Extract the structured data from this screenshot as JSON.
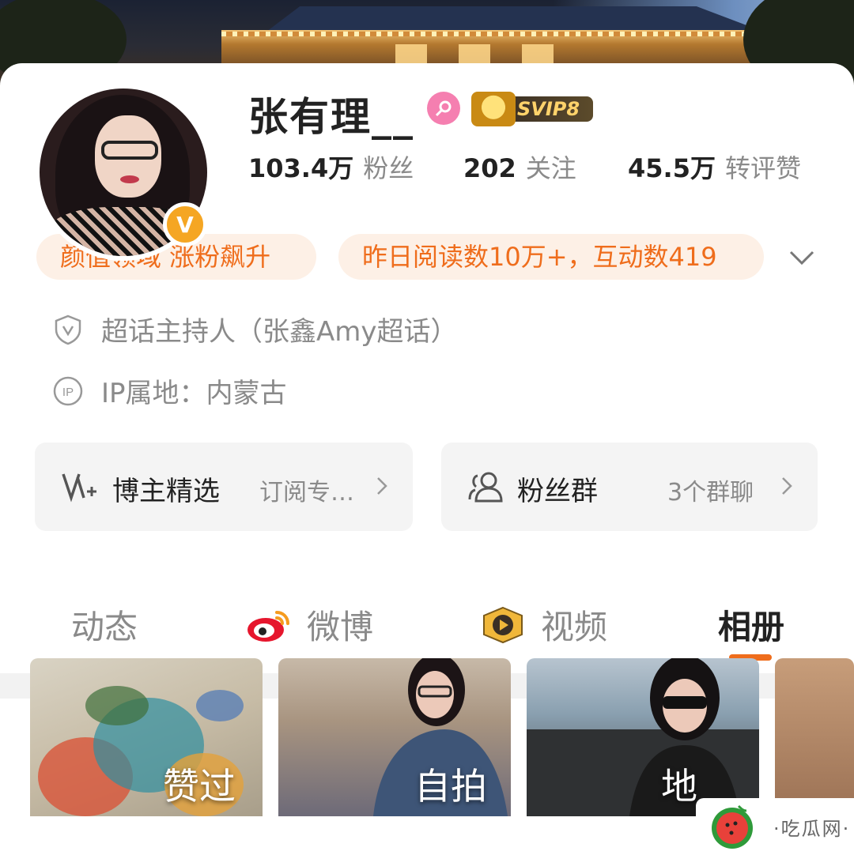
{
  "profile": {
    "username": "张有理__",
    "gender_icon": "female-icon",
    "vip_label": "SVIP8",
    "verified_badge": "V",
    "stats": [
      {
        "value": "103.4万",
        "label": "粉丝"
      },
      {
        "value": "202",
        "label": "关注"
      },
      {
        "value": "45.5万",
        "label": "转评赞"
      }
    ]
  },
  "tags": {
    "chip1": "颜值领域 涨粉飙升",
    "chip2": "昨日阅读数10万+，互动数419"
  },
  "info": {
    "super_host": "超话主持人（张鑫Amy超话）",
    "ip_location": "IP属地：内蒙古"
  },
  "panels": {
    "featured": {
      "title": "博主精选",
      "sub": "订阅专…"
    },
    "fan_group": {
      "title": "粉丝群",
      "sub": "3个群聊"
    }
  },
  "tabs": [
    {
      "label": "动态",
      "icon": "",
      "active": false
    },
    {
      "label": "微博",
      "icon": "weibo-icon",
      "active": false
    },
    {
      "label": "视频",
      "icon": "video-icon",
      "active": false
    },
    {
      "label": "相册",
      "icon": "",
      "active": true
    }
  ],
  "album": [
    {
      "caption": "赞过"
    },
    {
      "caption": "自拍"
    },
    {
      "caption": "地"
    },
    {
      "caption": ""
    }
  ],
  "watermark": {
    "text": "·吃瓜网·"
  },
  "colors": {
    "accent": "#ef6d1c",
    "chip_bg": "#fdf0e6",
    "panel_bg": "#f4f4f4",
    "verified": "#f5a623",
    "gender": "#f57fb0"
  }
}
